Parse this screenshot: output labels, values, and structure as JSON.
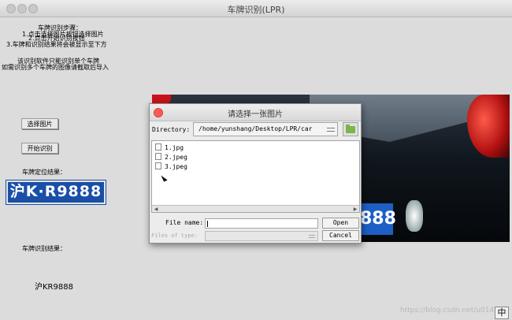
{
  "window": {
    "title": "车牌识别(LPR)"
  },
  "instructions": {
    "heading": "车牌识别步骤：",
    "step1": "1.点击选择图片按钮选择图片",
    "step2": "2.点击开始识别按钮",
    "step3": "3.车牌和识别结果将会被显示至下方",
    "note1": "该识别软件只能识别单个车牌",
    "note2": "如需识别多个车牌的图像请截取后导入"
  },
  "buttons": {
    "select_image": "选择图片",
    "start_recognize": "开始识别"
  },
  "labels": {
    "locate_result": "车牌定位结果：",
    "recognize_result": "车牌识别结果："
  },
  "plate": {
    "text": "沪K·R9888"
  },
  "result": {
    "text": "沪KR9888"
  },
  "photo": {
    "plate_partial": "888"
  },
  "watermark": "https://blog.csdn.net/u014538",
  "ime": "中",
  "dialog": {
    "title": "请选择一张图片",
    "directory_label": "Directory:",
    "directory_value": "/home/yunshang/Desktop/LPR/car",
    "files": [
      "1.jpg",
      "2.jpeg",
      "3.jpeg"
    ],
    "file_name_label": "File name:",
    "file_name_value": "",
    "files_of_type_label": "Files of type:",
    "open_button": "Open",
    "cancel_button": "Cancel"
  }
}
